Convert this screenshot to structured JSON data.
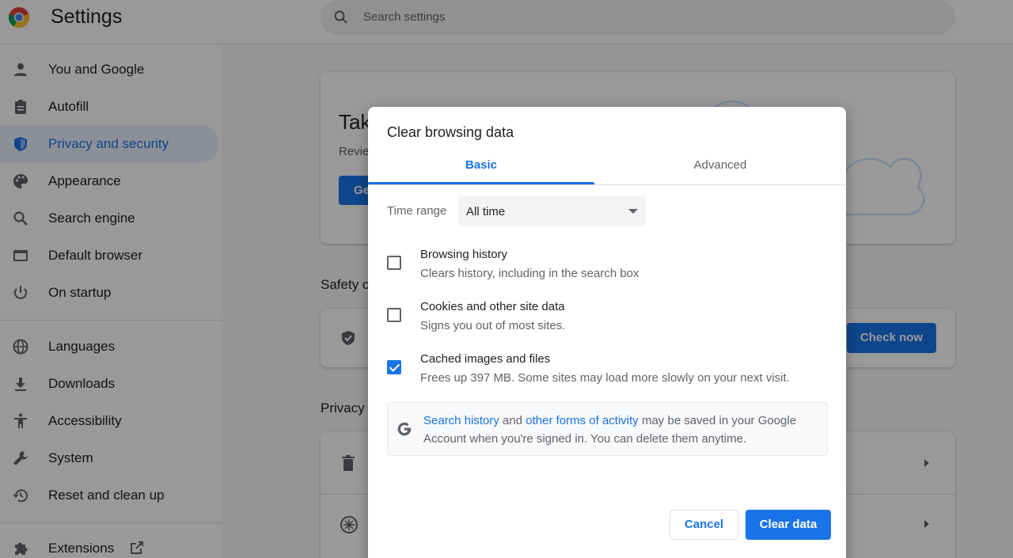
{
  "app": {
    "title": "Settings"
  },
  "search": {
    "placeholder": "Search settings"
  },
  "sidebar": {
    "items": [
      {
        "label": "You and Google",
        "icon": "person-icon"
      },
      {
        "label": "Autofill",
        "icon": "clipboard-icon"
      },
      {
        "label": "Privacy and security",
        "icon": "shield-icon",
        "active": true
      },
      {
        "label": "Appearance",
        "icon": "palette-icon"
      },
      {
        "label": "Search engine",
        "icon": "search-icon"
      },
      {
        "label": "Default browser",
        "icon": "browser-icon"
      },
      {
        "label": "On startup",
        "icon": "power-icon"
      },
      {
        "label": "Languages",
        "icon": "globe-icon"
      },
      {
        "label": "Downloads",
        "icon": "download-icon"
      },
      {
        "label": "Accessibility",
        "icon": "accessibility-icon"
      },
      {
        "label": "System",
        "icon": "wrench-icon"
      },
      {
        "label": "Reset and clean up",
        "icon": "restore-icon"
      },
      {
        "label": "Extensions",
        "icon": "puzzle-icon"
      }
    ]
  },
  "background": {
    "card_title_fragment": "Tak",
    "card_sub_fragment": "Revie",
    "card_button_fragment": "Ge",
    "safety_title_fragment": "Safety c",
    "check_now_label": "Check now",
    "privacy_title_fragment": "Privacy"
  },
  "dialog": {
    "title": "Clear browsing data",
    "tabs": [
      "Basic",
      "Advanced"
    ],
    "time_range": {
      "label": "Time range",
      "value": "All time"
    },
    "options": [
      {
        "title": "Browsing history",
        "subtitle": "Clears history, including in the search box",
        "checked": false
      },
      {
        "title": "Cookies and other site data",
        "subtitle": "Signs you out of most sites.",
        "checked": false
      },
      {
        "title": "Cached images and files",
        "subtitle": "Frees up 397 MB. Some sites may load more slowly on your next visit.",
        "checked": true
      }
    ],
    "info": {
      "link1": "Search history",
      "and": "and",
      "link2": "other forms of activity",
      "rest": "may be saved in your Google Account when you're signed in. You can delete them anytime."
    },
    "cancel_label": "Cancel",
    "clear_label": "Clear data"
  },
  "colors": {
    "accent": "#1a73e8",
    "overlay": "rgba(0,0,0,0.4)"
  }
}
